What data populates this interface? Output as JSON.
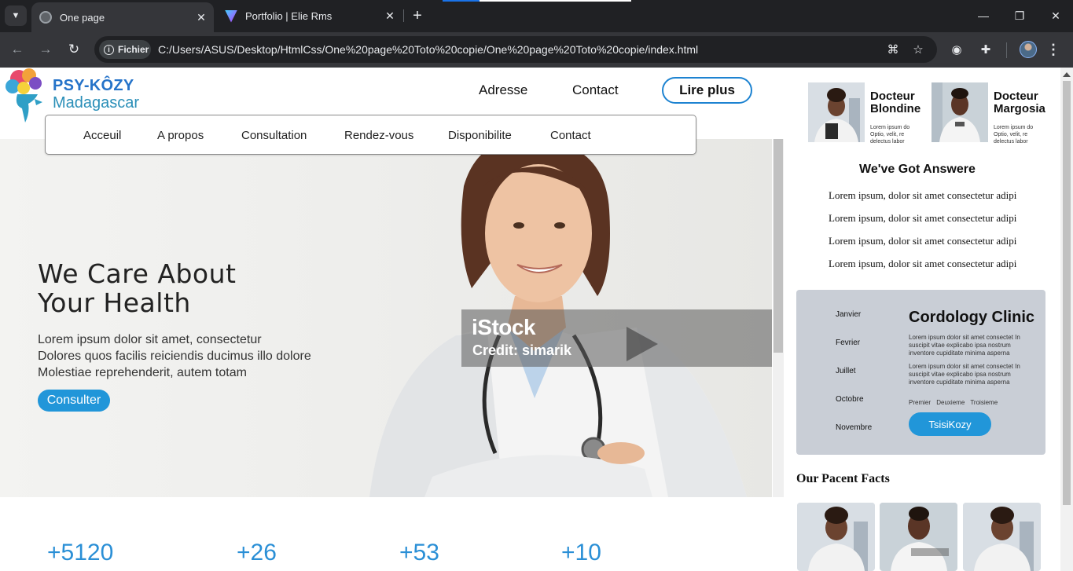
{
  "browser": {
    "tabs": [
      {
        "title": "One page",
        "active": true,
        "icon": "globe-icon"
      },
      {
        "title": "Portfolio | Elie Rms",
        "active": false,
        "icon": "vite-icon"
      }
    ],
    "new_tab": "+",
    "close_glyph": "✕",
    "chip_label": "Fichier",
    "url": "C:/Users/ASUS/Desktop/HtmlCss/One%20page%20Toto%20copie/One%20page%20Toto%20copie/index.html",
    "colors": {
      "chrome_dark": "#202124",
      "chrome": "#35363a",
      "accent": "#1a73e8"
    }
  },
  "site": {
    "logo": {
      "title": "PSY-KÔZY",
      "subtitle": "Madagascar"
    },
    "top_links": [
      "Adresse",
      "Contact"
    ],
    "cta_label": "Lire plus",
    "nav": [
      "Acceuil",
      "A propos",
      "Consultation",
      "Rendez-vous",
      "Disponibilite",
      "Contact"
    ],
    "hero": {
      "title_line1": "We Care About",
      "title_line2": "Your Health",
      "text_line1": "Lorem ipsum dolor sit amet, consectetur",
      "text_line2": "Dolores quos facilis reiciendis ducimus illo dolore",
      "text_line3": "Molestiae reprehenderit, autem totam",
      "button": "Consulter",
      "watermark_brand": "iStock",
      "watermark_credit": "Credit: simarik"
    },
    "stats": [
      "+5120",
      "+26",
      "+53",
      "+10"
    ],
    "colors": {
      "primary": "#2196d9",
      "stat_blue": "#2a8fd6",
      "clinic_bg": "#c9ced6"
    }
  },
  "sidebar": {
    "doctors": [
      {
        "name_line1": "Docteur",
        "name_line2": "Blondine",
        "desc": "Lorem ipsum do Optio, velit, re delectus labor"
      },
      {
        "name_line1": "Docteur",
        "name_line2": "Margosia",
        "desc": "Lorem ipsum do Optio, velit, re delectus labor"
      }
    ],
    "answers_title": "We've Got Answere",
    "answers": [
      "Lorem ipsum, dolor sit amet consectetur adipi",
      "Lorem ipsum, dolor sit amet consectetur adipi",
      "Lorem ipsum, dolor sit amet consectetur adipi",
      "Lorem ipsum, dolor sit amet consectetur adipi"
    ],
    "clinic": {
      "months": [
        "Janvier",
        "Fevrier",
        "Juillet",
        "Octobre",
        "Novembre"
      ],
      "title": "Cordology Clinic",
      "para1": "Lorem ipsum dolor sit amet consectet In suscipit vitae explicabo ipsa nostrum inventore cupiditate minima asperna",
      "para2": "Lorem ipsum dolor sit amet consectet In suscipit vitae explicabo ipsa nostrum inventore cupiditate minima asperna",
      "tabs": [
        "Premier",
        "Deuxieme",
        "Troisieme"
      ],
      "button": "TsisiKozy"
    },
    "facts_title": "Our Pacent Facts"
  }
}
